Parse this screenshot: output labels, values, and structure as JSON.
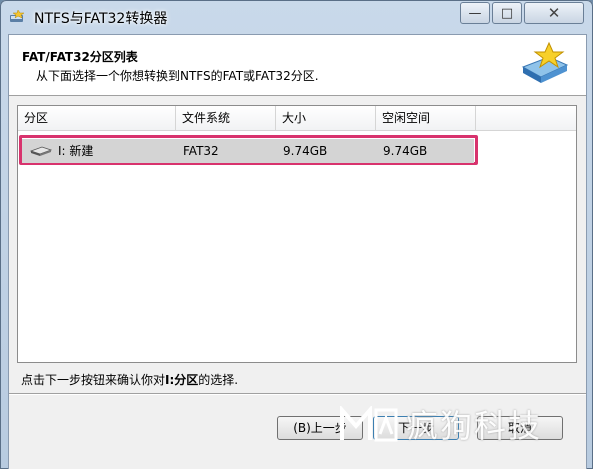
{
  "window": {
    "title": "NTFS与FAT32转换器",
    "controls": {
      "minimize": "—",
      "maximize": "□",
      "close": "✕"
    }
  },
  "header": {
    "title": "FAT/FAT32分区列表",
    "subtitle": "从下面选择一个你想转换到NTFS的FAT或FAT32分区."
  },
  "list": {
    "columns": [
      "分区",
      "文件系统",
      "大小",
      "空闲空间"
    ],
    "rows": [
      {
        "partition": "I: 新建",
        "filesystem": "FAT32",
        "size": "9.74GB",
        "free": "9.74GB",
        "selected": true
      }
    ]
  },
  "status": {
    "prefix": "点击下一步按钮来确认你对",
    "partition": "I:分区",
    "suffix": "的选择."
  },
  "buttons": {
    "back": "(B)上一步",
    "next": "下一步",
    "cancel": "取消"
  },
  "watermark": {
    "text": "疯狗科技"
  },
  "colors": {
    "selection_frame": "#d8336d",
    "row_bg": "#d4d4d4"
  }
}
